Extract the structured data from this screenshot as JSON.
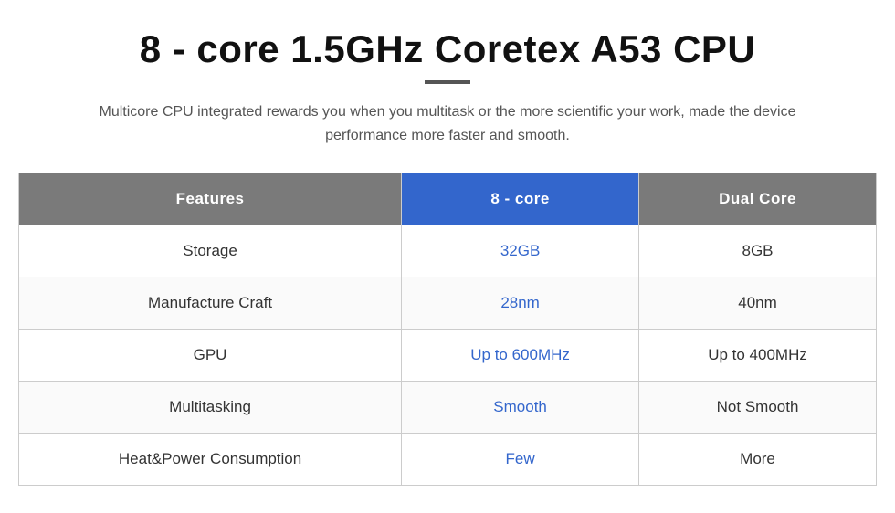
{
  "title": "8 - core 1.5GHz Coretex A53 CPU",
  "subtitle": "Multicore CPU integrated rewards you when you multitask or the more scientific your work, made the device performance more faster and smooth.",
  "table": {
    "headers": {
      "features": "Features",
      "eight_core": "8 - core",
      "dual_core": "Dual Core"
    },
    "rows": [
      {
        "feature": "Storage",
        "eight_core": "32GB",
        "dual_core": "8GB"
      },
      {
        "feature": "Manufacture Craft",
        "eight_core": "28nm",
        "dual_core": "40nm"
      },
      {
        "feature": "GPU",
        "eight_core": "Up to 600MHz",
        "dual_core": "Up to 400MHz"
      },
      {
        "feature": "Multitasking",
        "eight_core": "Smooth",
        "dual_core": "Not Smooth"
      },
      {
        "feature": "Heat&Power Consumption",
        "eight_core": "Few",
        "dual_core": "More"
      }
    ]
  }
}
